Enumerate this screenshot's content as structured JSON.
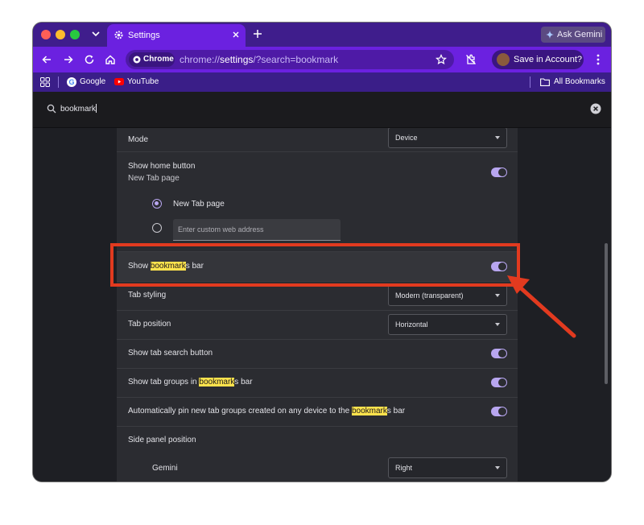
{
  "browser": {
    "tab_title": "Settings",
    "ask_gemini": "Ask Gemini",
    "chip_label": "Chrome",
    "url_prefix": "chrome://",
    "url_host": "settings",
    "url_path": "/?search=bookmark",
    "save_account": "Save in Account?",
    "bookmarks": [
      {
        "label": "Google"
      },
      {
        "label": "YouTube"
      }
    ],
    "all_bookmarks": "All Bookmarks"
  },
  "search": {
    "value": "bookmark"
  },
  "settings": {
    "mode": {
      "label": "Mode",
      "value": "Device"
    },
    "home_button": {
      "label": "Show home button",
      "sublabel": "New Tab page",
      "enabled": true
    },
    "home_options": {
      "new_tab_label": "New Tab page",
      "custom_placeholder": "Enter custom web address"
    },
    "bookmarks_bar": {
      "pre": "Show ",
      "match": "bookmark",
      "post": "s bar",
      "enabled": true
    },
    "tab_styling": {
      "label": "Tab styling",
      "value": "Modern (transparent)"
    },
    "tab_position": {
      "label": "Tab position",
      "value": "Horizontal"
    },
    "tab_search": {
      "label": "Show tab search button",
      "enabled": true
    },
    "tab_groups": {
      "pre": "Show tab groups in ",
      "match": "bookmark",
      "post": "s bar",
      "enabled": true
    },
    "auto_pin": {
      "pre": "Automatically pin new tab groups created on any device to the ",
      "match": "bookmark",
      "post": "s bar",
      "enabled": true
    },
    "side_panel": {
      "label": "Side panel position"
    },
    "gemini": {
      "label": "Gemini",
      "value": "Right"
    }
  },
  "colors": {
    "titlebar": "#3f1d8c",
    "toolbar": "#6b21e0",
    "highlight": "#ffe34d",
    "toggle_on": "#b8a6f0",
    "annotation": "#e23a1f"
  }
}
